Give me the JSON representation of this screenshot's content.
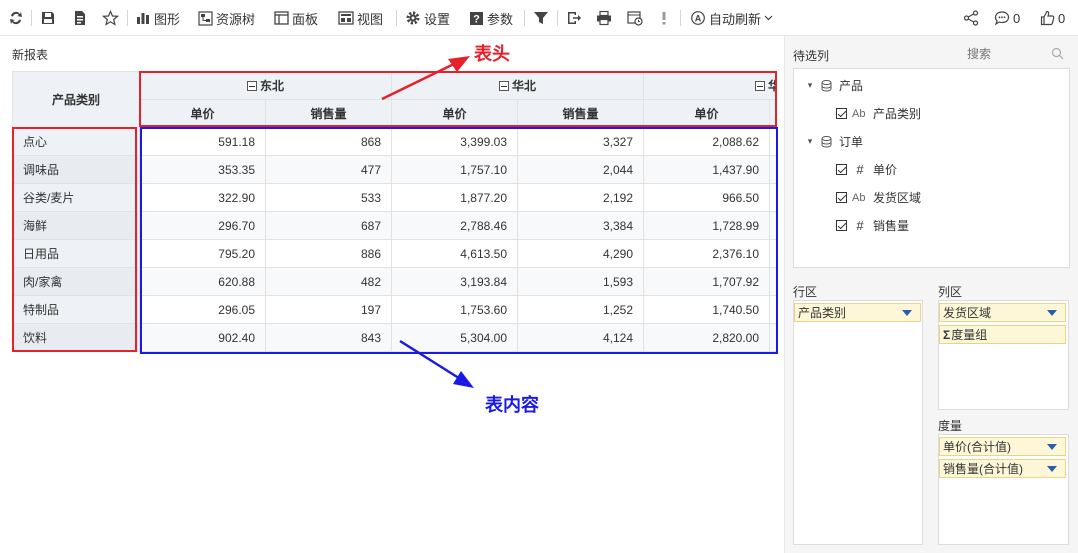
{
  "toolbar": {
    "chart": "图形",
    "resource_tree": "资源树",
    "panel": "面板",
    "view": "视图",
    "settings": "设置",
    "params": "参数",
    "auto_refresh": "自动刷新",
    "comments_count": "0",
    "likes_count": "0"
  },
  "report_title": "新报表",
  "table": {
    "row_header_title": "产品类别",
    "regions": [
      "东北",
      "华北",
      "华"
    ],
    "measure_headers": [
      "单价",
      "销售量",
      "单价",
      "销售量",
      "单价"
    ],
    "rows": [
      {
        "category": "点心",
        "values": [
          "591.18",
          "868",
          "3,399.03",
          "3,327",
          "2,088.62"
        ]
      },
      {
        "category": "调味品",
        "values": [
          "353.35",
          "477",
          "1,757.10",
          "2,044",
          "1,437.90"
        ]
      },
      {
        "category": "谷类/麦片",
        "values": [
          "322.90",
          "533",
          "1,877.20",
          "2,192",
          "966.50"
        ]
      },
      {
        "category": "海鲜",
        "values": [
          "296.70",
          "687",
          "2,788.46",
          "3,384",
          "1,728.99"
        ]
      },
      {
        "category": "日用品",
        "values": [
          "795.20",
          "886",
          "4,613.50",
          "4,290",
          "2,376.10"
        ]
      },
      {
        "category": "肉/家禽",
        "values": [
          "620.88",
          "482",
          "3,193.84",
          "1,593",
          "1,707.92"
        ]
      },
      {
        "category": "特制品",
        "values": [
          "296.05",
          "197",
          "1,753.60",
          "1,252",
          "1,740.50"
        ]
      },
      {
        "category": "饮料",
        "values": [
          "902.40",
          "843",
          "5,304.00",
          "4,124",
          "2,820.00"
        ]
      }
    ]
  },
  "annotations": {
    "header_label": "表头",
    "content_label": "表内容",
    "header_color": "#e8202a",
    "content_color": "#1a1ae6"
  },
  "right_panel": {
    "candidates_label": "待选列",
    "search_placeholder": "搜索",
    "tree": {
      "groups": [
        {
          "name": "产品",
          "fields": [
            {
              "type": "Ab",
              "name": "产品类别"
            }
          ]
        },
        {
          "name": "订单",
          "fields": [
            {
              "type": "#",
              "name": "单价"
            },
            {
              "type": "Ab",
              "name": "发货区域"
            },
            {
              "type": "#",
              "name": "销售量"
            }
          ]
        }
      ]
    },
    "rows_zone_label": "行区",
    "cols_zone_label": "列区",
    "measures_zone_label": "度量",
    "rows_chip": "产品类别",
    "cols_chip": "发货区域",
    "measure_group_chip": "度量组",
    "measure_chips": [
      "单价(合计值)",
      "销售量(合计值)"
    ]
  }
}
